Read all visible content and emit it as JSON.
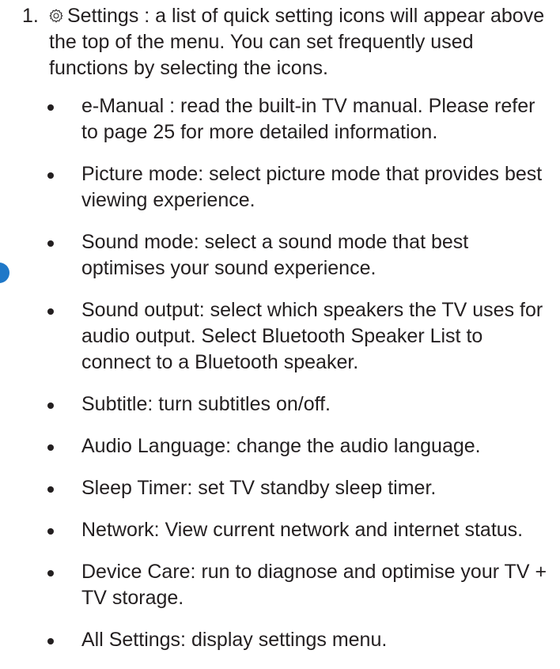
{
  "step": {
    "number": "1.",
    "icon": "gear-icon",
    "text": "Settings : a list of quick setting icons will appear above the top of the menu. You can set frequently used functions by selecting the icons."
  },
  "items": [
    {
      "text": "e-Manual : read the built-in TV manual. Please refer to page 25 for more detailed information."
    },
    {
      "text": "Picture mode: select picture mode that provides best viewing experience."
    },
    {
      "text": "Sound mode: select a sound mode that best optimises your sound experience."
    },
    {
      "text": "Sound output: select which speakers the TV uses for audio output. Select Bluetooth Speaker List to connect to a Bluetooth speaker."
    },
    {
      "text": "Subtitle: turn subtitles on/off."
    },
    {
      "text": "Audio Language: change the audio language."
    },
    {
      "text": "Sleep Timer: set TV standby sleep timer."
    },
    {
      "text": "Network: View current network and internet status."
    },
    {
      "text": "Device Care: run to diagnose and optimise your TV + TV storage."
    },
    {
      "text": "All Settings: display settings menu."
    }
  ],
  "colors": {
    "text": "#231f20",
    "accent": "#1f78c8"
  }
}
